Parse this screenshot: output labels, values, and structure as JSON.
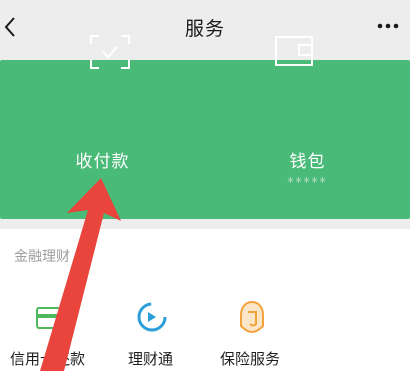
{
  "nav": {
    "title": "服务"
  },
  "green_card": {
    "pay": {
      "label": "收付款"
    },
    "wallet": {
      "label": "钱包",
      "sub": "*****"
    }
  },
  "finance": {
    "title": "金融理财",
    "items": [
      {
        "label": "信用卡还款",
        "icon": "credit-card-icon"
      },
      {
        "label": "理财通",
        "icon": "licaitong-icon"
      },
      {
        "label": "保险服务",
        "icon": "insurance-icon"
      }
    ]
  },
  "colors": {
    "green_card": "#4aba78",
    "icon_teal": "#2c9fd8",
    "icon_green": "#4cb95d",
    "icon_orange": "#f3a23c",
    "annotation_arrow": "#e9453d"
  }
}
